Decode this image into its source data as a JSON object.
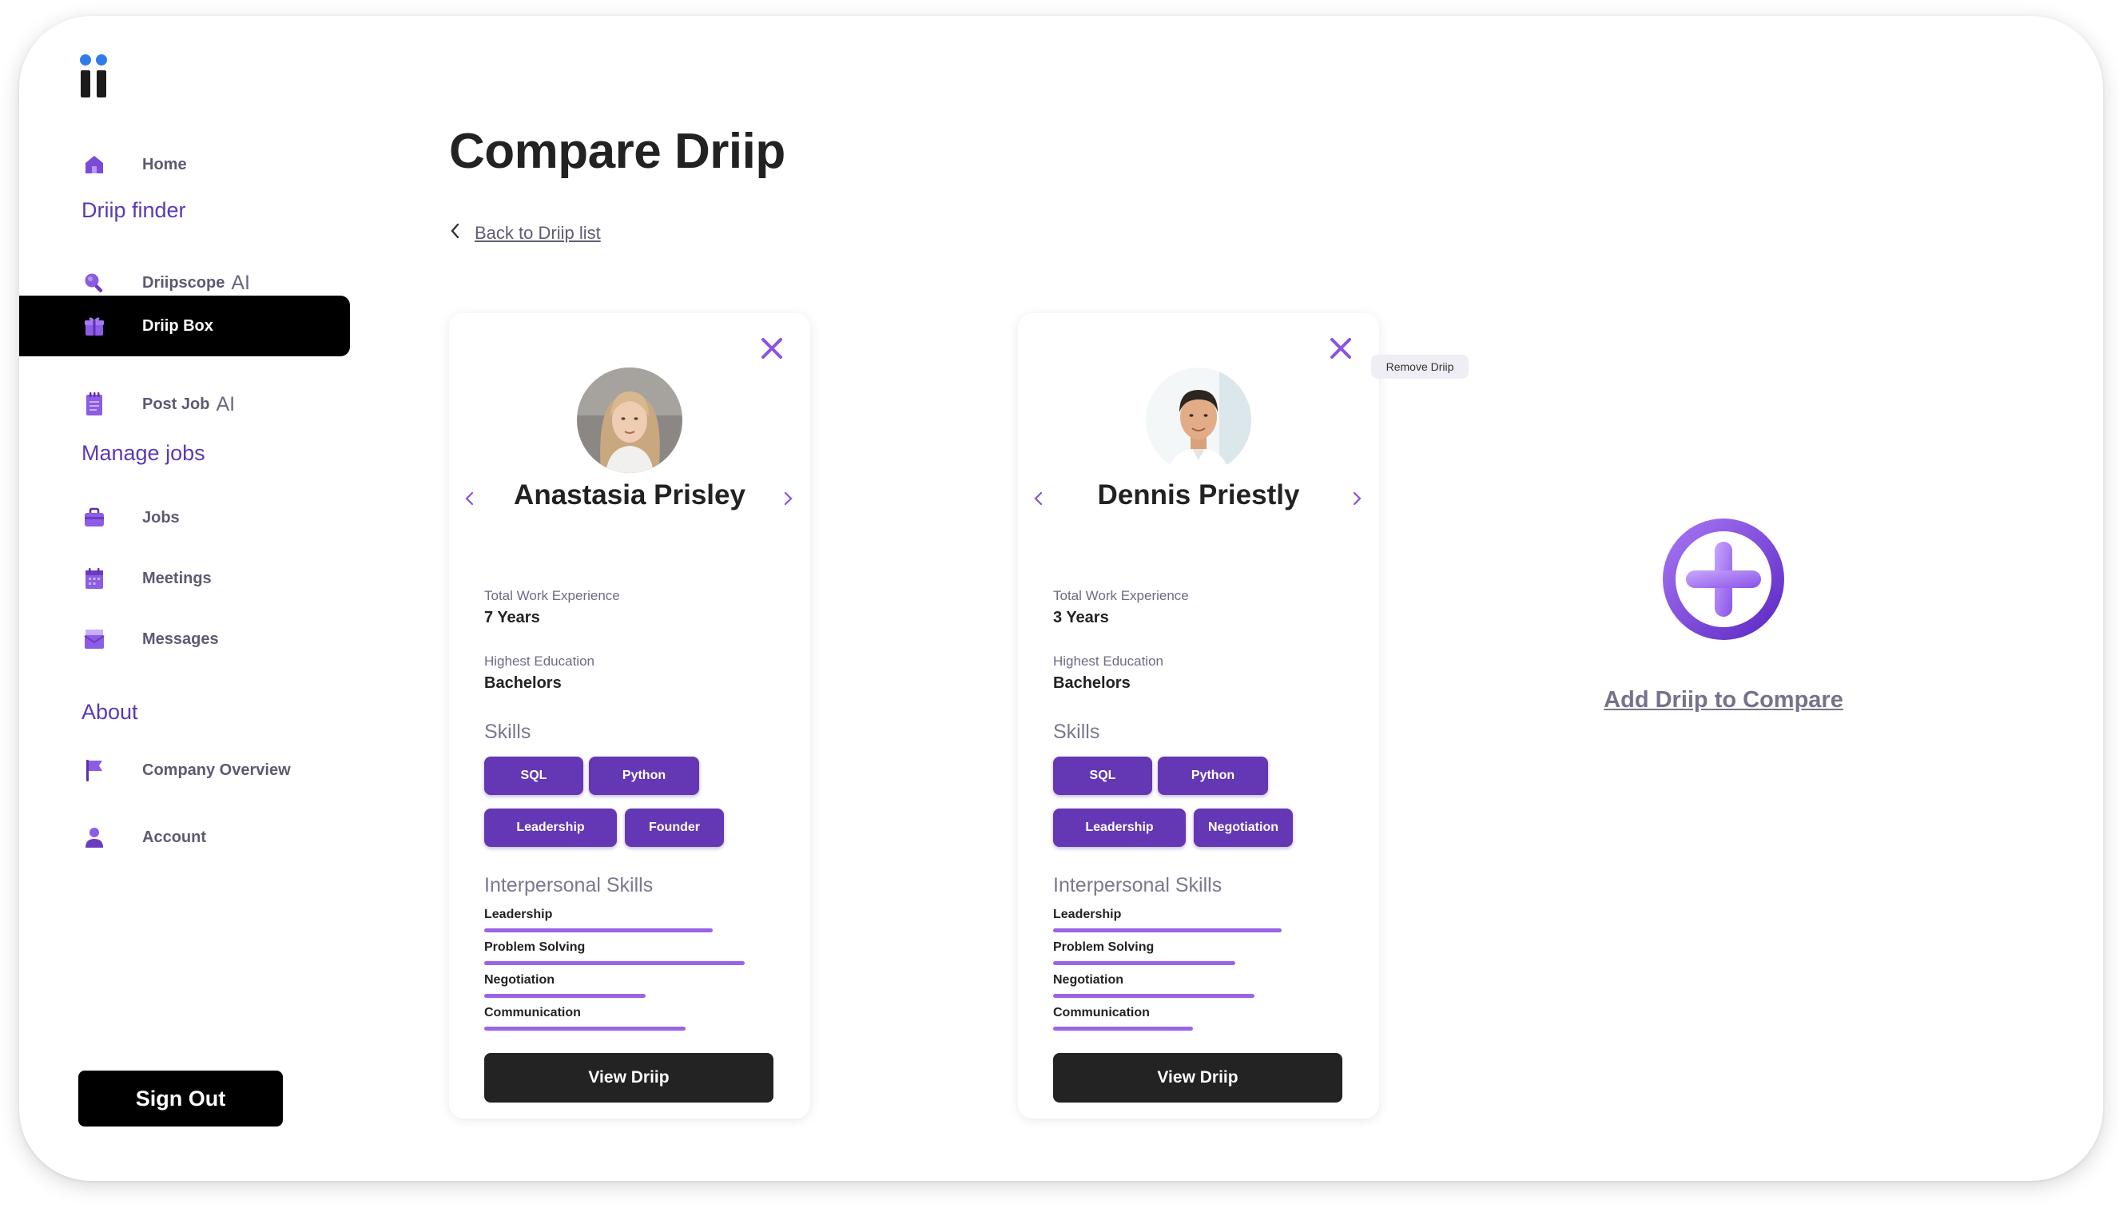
{
  "sidebar": {
    "items": [
      {
        "key": "home",
        "label": "Home",
        "ai": "",
        "icon": "home-icon"
      },
      {
        "key": "driipscope",
        "label": "Driipscope",
        "ai": "AI",
        "icon": "search-icon"
      },
      {
        "key": "driip-box",
        "label": "Driip Box",
        "ai": "",
        "icon": "gift-box-icon",
        "active": true
      },
      {
        "key": "post-job",
        "label": "Post Job",
        "ai": "AI",
        "icon": "notepad-icon"
      },
      {
        "key": "jobs",
        "label": "Jobs",
        "ai": "",
        "icon": "briefcase-icon"
      },
      {
        "key": "meetings",
        "label": "Meetings",
        "ai": "",
        "icon": "calendar-icon"
      },
      {
        "key": "messages",
        "label": "Messages",
        "ai": "",
        "icon": "mail-icon"
      },
      {
        "key": "company-overview",
        "label": "Company Overview",
        "ai": "",
        "icon": "flag-icon"
      },
      {
        "key": "account",
        "label": "Account",
        "ai": "",
        "icon": "user-icon"
      }
    ],
    "sections": {
      "driip_finder": "Driip finder",
      "manage_jobs": "Manage jobs",
      "about": "About"
    },
    "sign_out": "Sign Out"
  },
  "main": {
    "title": "Compare Driip",
    "back_link": "Back to Driip list",
    "tooltip": "Remove Driip",
    "add_label": "Add Driip to Compare",
    "candidates": [
      {
        "name": "Anastasia Prisley",
        "experience_label": "Total Work Experience",
        "experience": "7 Years",
        "education_label": "Highest Education",
        "education": "Bachelors",
        "skills_heading": "Skills",
        "skills": [
          "SQL",
          "Python",
          "Leadership",
          "Founder"
        ],
        "interpersonal_heading": "Interpersonal Skills",
        "interpersonal": [
          {
            "name": "Leadership",
            "level": 0.85
          },
          {
            "name": "Problem Solving",
            "level": 0.97
          },
          {
            "name": "Negotiation",
            "level": 0.6
          },
          {
            "name": "Communication",
            "level": 0.75
          }
        ],
        "view_label": "View Driip"
      },
      {
        "name": "Dennis Priestly",
        "experience_label": "Total Work Experience",
        "experience": "3 Years",
        "education_label": "Highest Education",
        "education": "Bachelors",
        "skills_heading": "Skills",
        "skills": [
          "SQL",
          "Python",
          "Leadership",
          "Negotiation"
        ],
        "interpersonal_heading": "Interpersonal Skills",
        "interpersonal": [
          {
            "name": "Leadership",
            "level": 0.85
          },
          {
            "name": "Problem Solving",
            "level": 0.68
          },
          {
            "name": "Negotiation",
            "level": 0.75
          },
          {
            "name": "Communication",
            "level": 0.52
          }
        ],
        "view_label": "View Driip"
      }
    ]
  },
  "colors": {
    "accent": "#6437b4",
    "accent_light": "#9b63e6",
    "section_heading": "#5b39b5",
    "active_nav_bg": "#000000"
  }
}
